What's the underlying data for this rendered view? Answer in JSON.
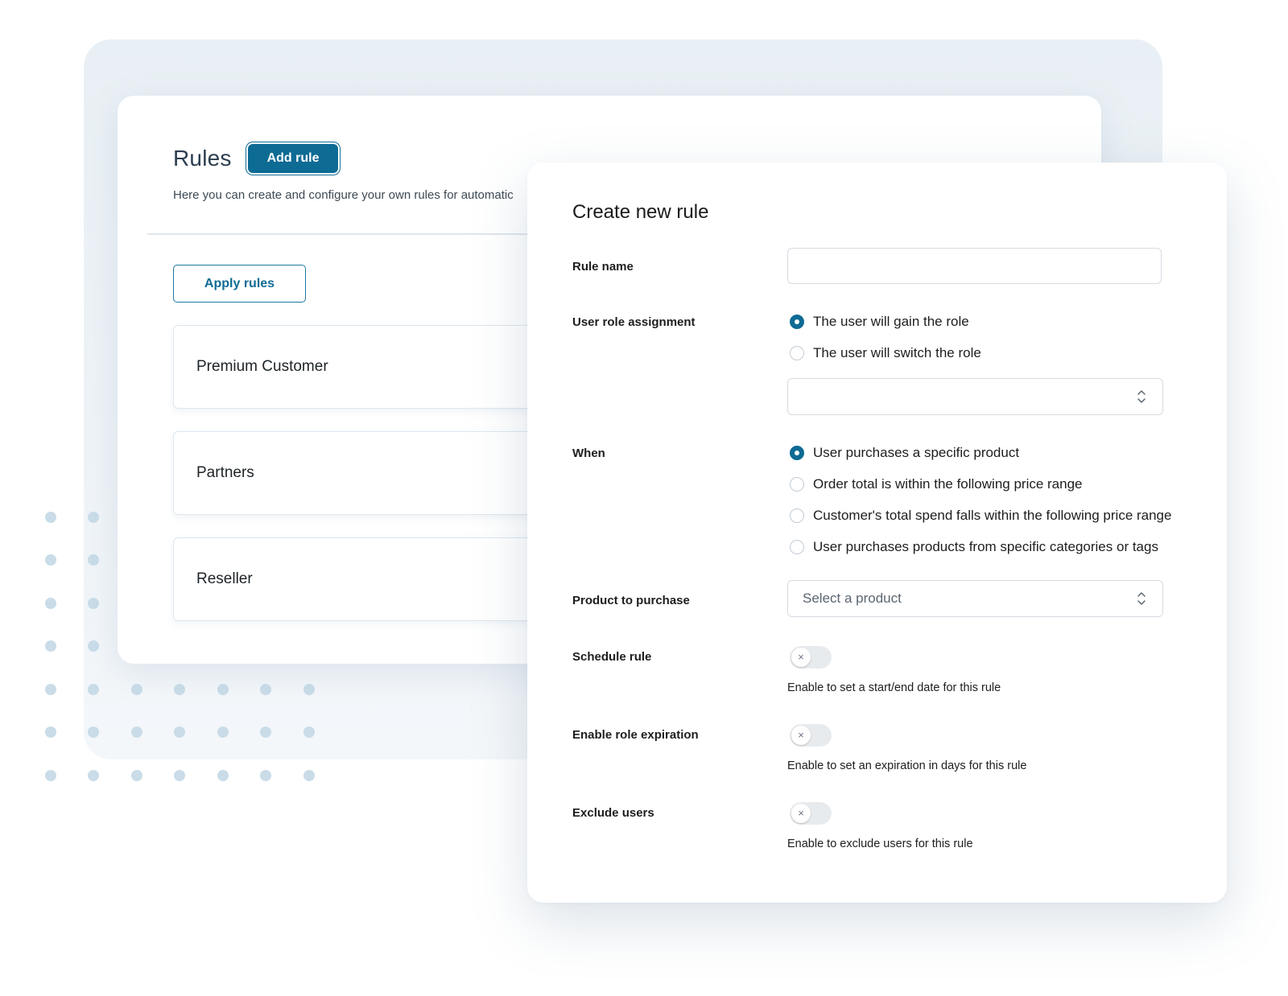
{
  "rules_page": {
    "title": "Rules",
    "add_rule_label": "Add rule",
    "description": "Here you can create and configure your own rules for automatic",
    "apply_rules_label": "Apply rules",
    "rules": [
      {
        "name": "Premium Customer"
      },
      {
        "name": "Partners"
      },
      {
        "name": "Reseller"
      }
    ]
  },
  "modal": {
    "title": "Create new rule",
    "rule_name": {
      "label": "Rule name",
      "value": ""
    },
    "role_assignment": {
      "label": "User role assignment",
      "options": [
        {
          "label": "The user will gain the role",
          "checked": true
        },
        {
          "label": "The user will switch the role",
          "checked": false
        }
      ],
      "role_select_value": ""
    },
    "when": {
      "label": "When",
      "options": [
        {
          "label": "User purchases a specific product",
          "checked": true
        },
        {
          "label": "Order total is within the following price range",
          "checked": false
        },
        {
          "label": "Customer's total spend falls within the following price range",
          "checked": false
        },
        {
          "label": "User purchases products from specific categories or tags",
          "checked": false
        }
      ]
    },
    "product": {
      "label": "Product to purchase",
      "placeholder": "Select a product"
    },
    "schedule": {
      "label": "Schedule rule",
      "enabled": false,
      "help": "Enable to set a start/end date for this rule"
    },
    "expiration": {
      "label": "Enable role expiration",
      "enabled": false,
      "help": "Enable to set an expiration in days for this rule"
    },
    "exclude": {
      "label": "Exclude users",
      "enabled": false,
      "help": "Enable to exclude users for this rule"
    },
    "toggle_off_glyph": "×"
  },
  "colors": {
    "accent": "#0e6b94",
    "dot": "#c9dce8",
    "backdrop": "#e9f0f5"
  }
}
